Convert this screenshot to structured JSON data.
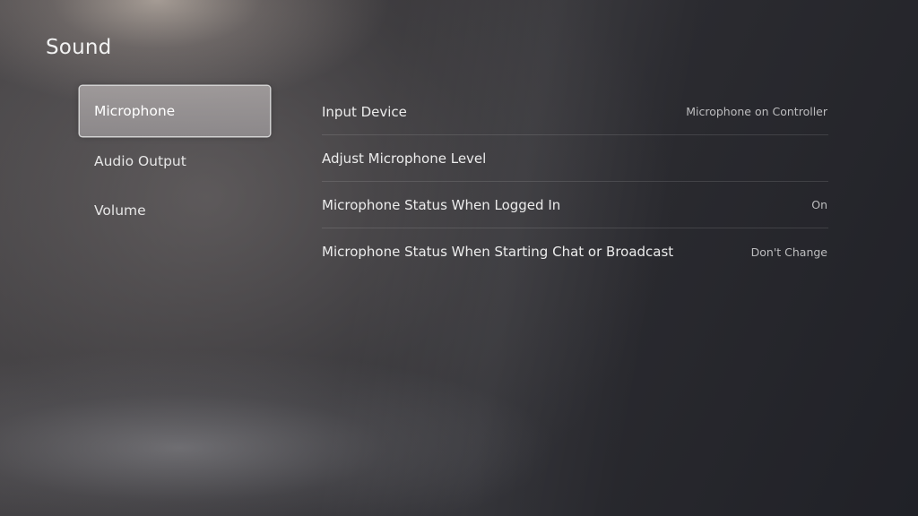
{
  "page": {
    "title": "Sound"
  },
  "nav": {
    "items": [
      {
        "label": "Microphone",
        "selected": true
      },
      {
        "label": "Audio Output",
        "selected": false
      },
      {
        "label": "Volume",
        "selected": false
      }
    ]
  },
  "settings": {
    "rows": [
      {
        "label": "Input Device",
        "value": "Microphone on Controller"
      },
      {
        "label": "Adjust Microphone Level",
        "value": ""
      },
      {
        "label": "Microphone Status When Logged In",
        "value": "On"
      },
      {
        "label": "Microphone Status When Starting Chat or Broadcast",
        "value": "Don't Change"
      }
    ]
  }
}
